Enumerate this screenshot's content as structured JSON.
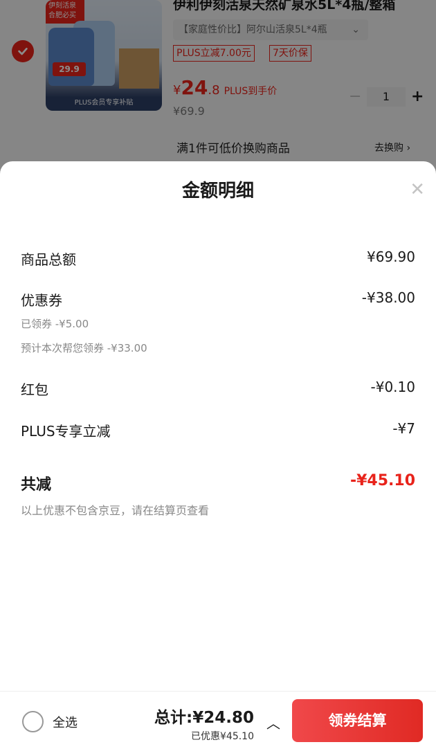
{
  "product": {
    "title": "伊利伊刻活泉天然矿泉水5L*4瓶/整箱",
    "spec": "【家庭性价比】阿尔山活泉5L*4瓶",
    "spec_arrow": "⌄",
    "tags": [
      "PLUS立减7.00元",
      "7天价保"
    ],
    "price_yen": "¥",
    "price_int": "24",
    "price_dec": ".8",
    "price_plus_label": "PLUS到手价",
    "original_price": "¥69.9",
    "quantity": "1",
    "thumb_brand": "伊刻活泉 合肥必买",
    "thumb_price": "29.9",
    "thumb_strip": "PLUS会员专享补贴"
  },
  "swap": {
    "text": "满1件可低价换购商品",
    "link": "去换购"
  },
  "sheet": {
    "title": "金额明细",
    "rows": [
      {
        "label": "商品总额",
        "amount": "¥69.90"
      },
      {
        "label": "优惠券",
        "amount": "-¥38.00"
      },
      {
        "label": "红包",
        "amount": "-¥0.10"
      },
      {
        "label": "PLUS专享立减",
        "amount": "-¥7"
      }
    ],
    "coupon_subs": [
      "已领券 -¥5.00",
      "预计本次帮您领券 -¥33.00"
    ],
    "total_label": "共减",
    "total_amount": "-¥45.10",
    "note": "以上优惠不包含京豆，请在结算页查看"
  },
  "bottom": {
    "select_all": "全选",
    "total": "总计:¥24.80",
    "saved": "已优惠¥45.10",
    "caret": "︿",
    "checkout": "领券结算"
  },
  "colors": {
    "accent": "#e8231b",
    "checkout_bg": "#e8302a"
  }
}
